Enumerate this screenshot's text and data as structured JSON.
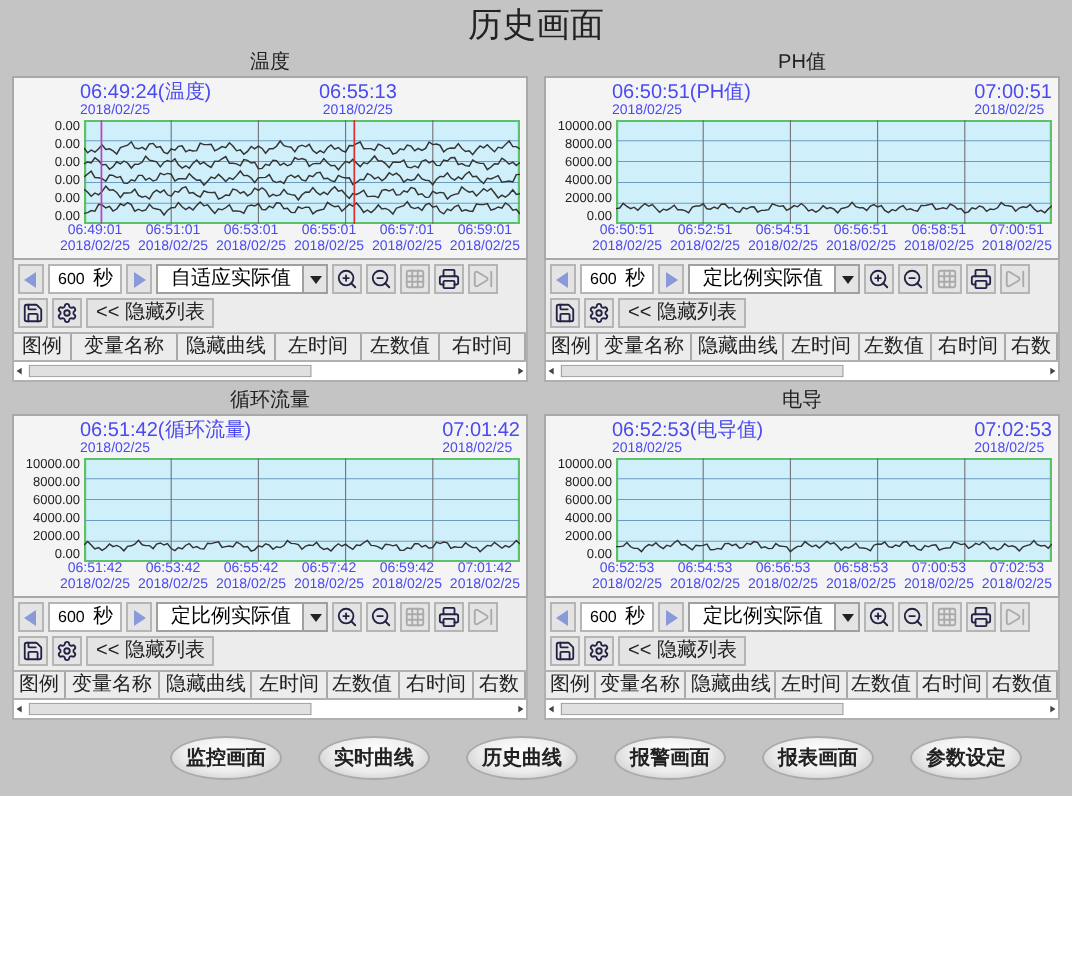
{
  "title": "历史画面",
  "panels": [
    {
      "title": "温度",
      "kind": "multi",
      "cursors": [
        {
          "kind": "edge",
          "time": "06:49:24(温度)",
          "date": "2018/02/25"
        },
        {
          "kind": "marker",
          "time": "06:55:13",
          "date": "2018/02/25"
        }
      ],
      "y_labels": [
        "0.00",
        "0.00",
        "0.00",
        "0.00",
        "0.00",
        "0.00"
      ],
      "x_labels": [
        {
          "time": "06:49:01",
          "date": "2018/02/25"
        },
        {
          "time": "06:51:01",
          "date": "2018/02/25"
        },
        {
          "time": "06:53:01",
          "date": "2018/02/25"
        },
        {
          "time": "06:55:01",
          "date": "2018/02/25"
        },
        {
          "time": "06:57:01",
          "date": "2018/02/25"
        },
        {
          "time": "06:59:01",
          "date": "2018/02/25"
        }
      ],
      "period": "600",
      "unit": "秒",
      "scale_mode": "自适应实际值",
      "hide_list": "<< 隐藏列表",
      "columns": [
        "图例",
        "变量名称",
        "隐藏曲线",
        "左时间",
        "左数值",
        "右时间"
      ]
    },
    {
      "title": "PH值",
      "kind": "single",
      "cursors": [
        {
          "kind": "edge",
          "time": "06:50:51(PH值)",
          "date": "2018/02/25"
        },
        {
          "kind": "edge",
          "time": "07:00:51",
          "date": "2018/02/25"
        }
      ],
      "y_labels": [
        "10000.00",
        "8000.00",
        "6000.00",
        "4000.00",
        "2000.00",
        "0.00"
      ],
      "x_labels": [
        {
          "time": "06:50:51",
          "date": "2018/02/25"
        },
        {
          "time": "06:52:51",
          "date": "2018/02/25"
        },
        {
          "time": "06:54:51",
          "date": "2018/02/25"
        },
        {
          "time": "06:56:51",
          "date": "2018/02/25"
        },
        {
          "time": "06:58:51",
          "date": "2018/02/25"
        },
        {
          "time": "07:00:51",
          "date": "2018/02/25"
        }
      ],
      "period": "600",
      "unit": "秒",
      "scale_mode": "定比例实际值",
      "hide_list": "<< 隐藏列表",
      "columns": [
        "图例",
        "变量名称",
        "隐藏曲线",
        "左时间",
        "左数值",
        "右时间",
        "右数"
      ]
    },
    {
      "title": "循环流量",
      "kind": "single",
      "cursors": [
        {
          "kind": "edge",
          "time": "06:51:42(循环流量)",
          "date": "2018/02/25"
        },
        {
          "kind": "edge",
          "time": "07:01:42",
          "date": "2018/02/25"
        }
      ],
      "y_labels": [
        "10000.00",
        "8000.00",
        "6000.00",
        "4000.00",
        "2000.00",
        "0.00"
      ],
      "x_labels": [
        {
          "time": "06:51:42",
          "date": "2018/02/25"
        },
        {
          "time": "06:53:42",
          "date": "2018/02/25"
        },
        {
          "time": "06:55:42",
          "date": "2018/02/25"
        },
        {
          "time": "06:57:42",
          "date": "2018/02/25"
        },
        {
          "time": "06:59:42",
          "date": "2018/02/25"
        },
        {
          "time": "07:01:42",
          "date": "2018/02/25"
        }
      ],
      "period": "600",
      "unit": "秒",
      "scale_mode": "定比例实际值",
      "hide_list": "<< 隐藏列表",
      "columns": [
        "图例",
        "变量名称",
        "隐藏曲线",
        "左时间",
        "左数值",
        "右时间",
        "右数"
      ]
    },
    {
      "title": "电导",
      "kind": "single",
      "cursors": [
        {
          "kind": "edge",
          "time": "06:52:53(电导值)",
          "date": "2018/02/25"
        },
        {
          "kind": "edge",
          "time": "07:02:53",
          "date": "2018/02/25"
        }
      ],
      "y_labels": [
        "10000.00",
        "8000.00",
        "6000.00",
        "4000.00",
        "2000.00",
        "0.00"
      ],
      "x_labels": [
        {
          "time": "06:52:53",
          "date": "2018/02/25"
        },
        {
          "time": "06:54:53",
          "date": "2018/02/25"
        },
        {
          "time": "06:56:53",
          "date": "2018/02/25"
        },
        {
          "time": "06:58:53",
          "date": "2018/02/25"
        },
        {
          "time": "07:00:53",
          "date": "2018/02/25"
        },
        {
          "time": "07:02:53",
          "date": "2018/02/25"
        }
      ],
      "period": "600",
      "unit": "秒",
      "scale_mode": "定比例实际值",
      "hide_list": "<< 隐藏列表",
      "columns": [
        "图例",
        "变量名称",
        "隐藏曲线",
        "左时间",
        "左数值",
        "右时间",
        "右数值"
      ]
    }
  ],
  "buttons": [
    "监控画面",
    "实时曲线",
    "历史曲线",
    "报警画面",
    "报表画面",
    "参数设定"
  ]
}
